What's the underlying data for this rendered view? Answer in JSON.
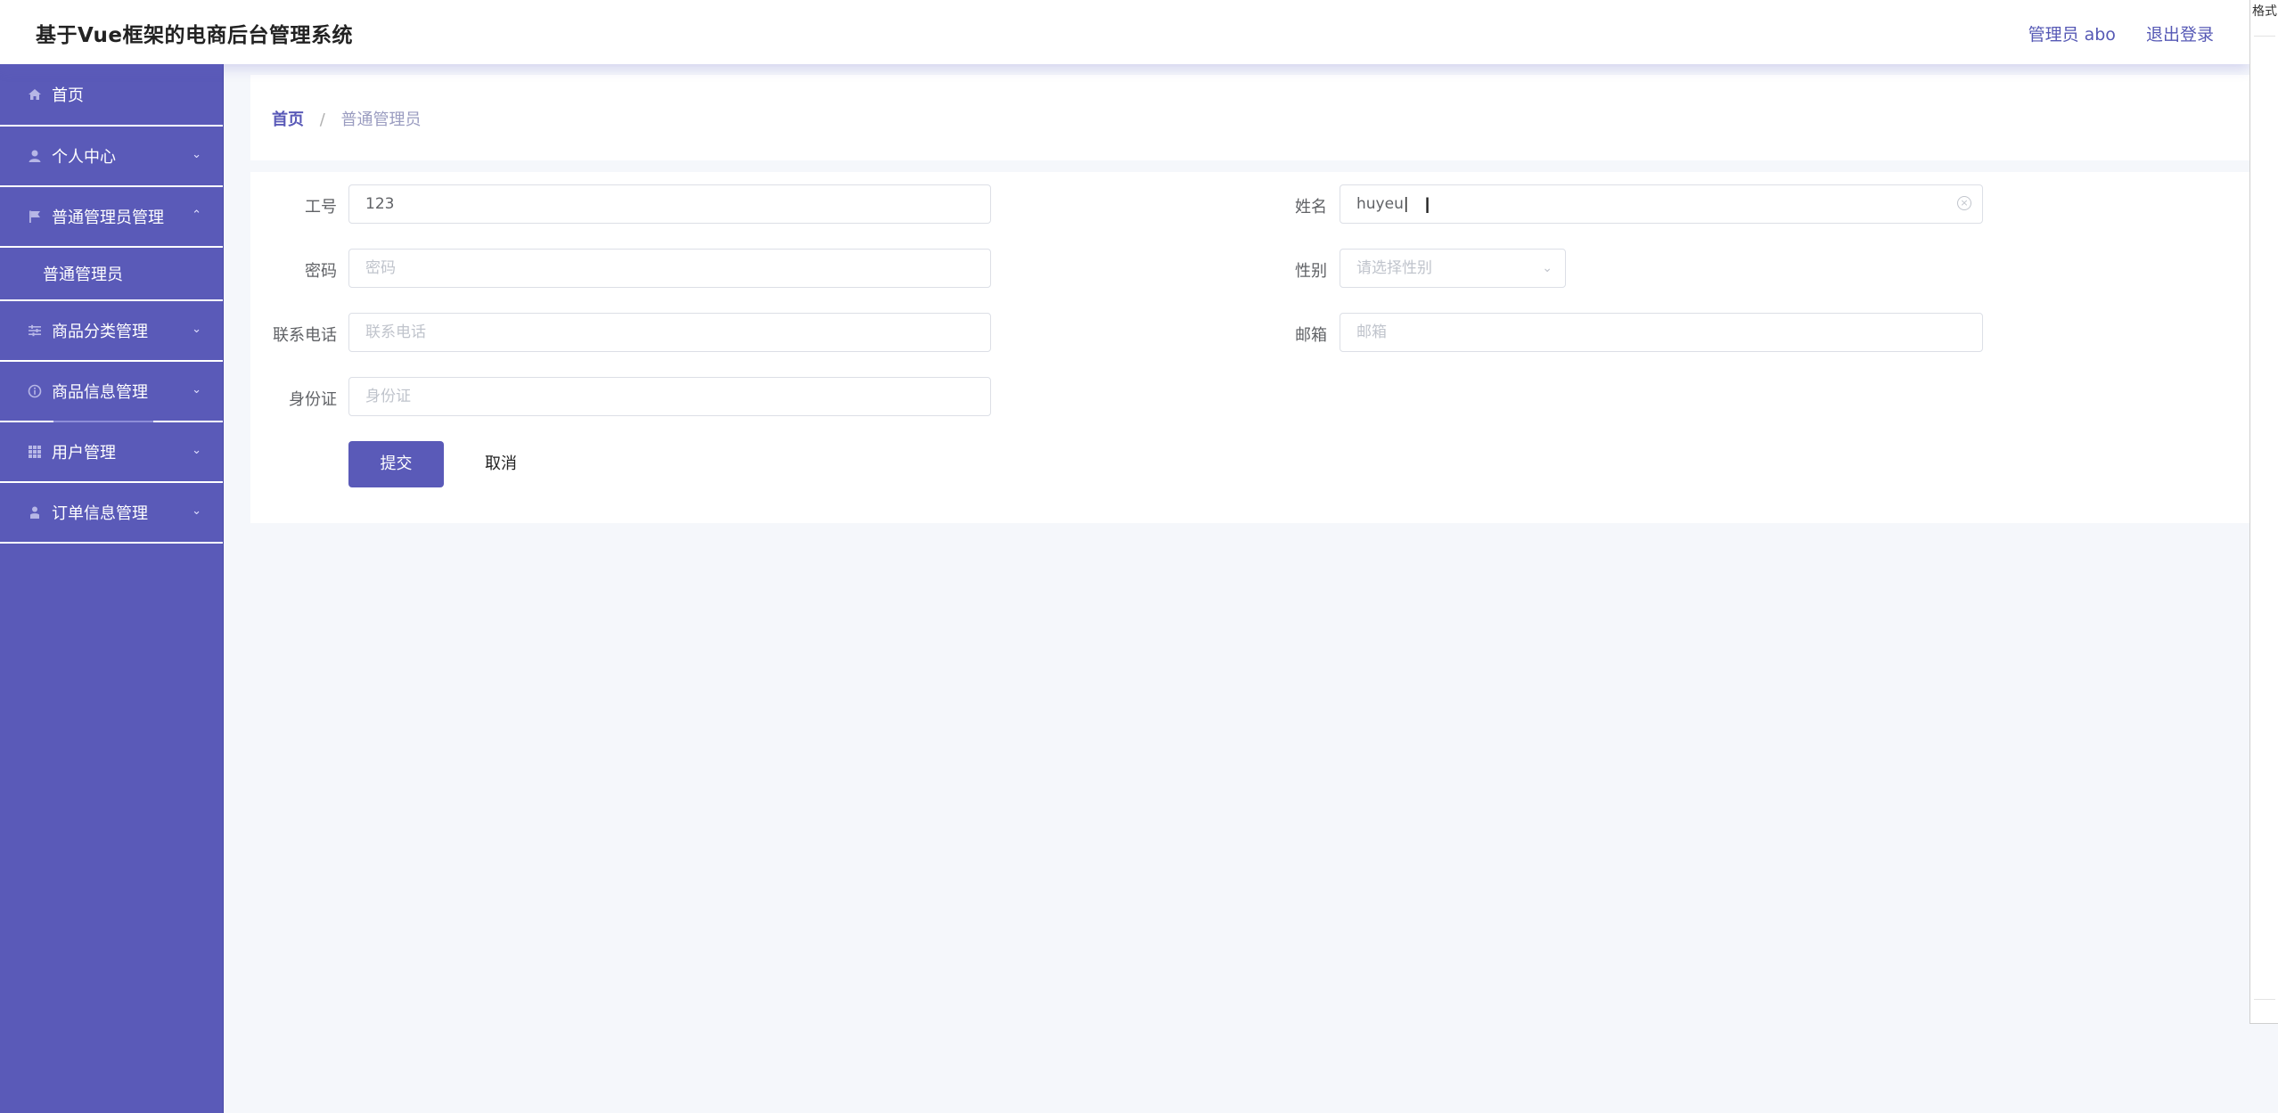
{
  "header": {
    "title": "基于Vue框架的电商后台管理系统",
    "user_label": "管理员 abo",
    "logout_label": "退出登录"
  },
  "side_window": {
    "fragment": "格式"
  },
  "sidebar": {
    "items": [
      {
        "label": "首页",
        "icon": "home-icon"
      },
      {
        "label": "个人中心",
        "icon": "user-icon"
      },
      {
        "label": "普通管理员管理",
        "icon": "flag-icon"
      },
      {
        "label": "普通管理员",
        "icon": ""
      },
      {
        "label": "商品分类管理",
        "icon": "sliders-icon"
      },
      {
        "label": "商品信息管理",
        "icon": "info-circle-icon"
      },
      {
        "label": "用户管理",
        "icon": "grid-icon"
      },
      {
        "label": "订单信息管理",
        "icon": "person-icon"
      }
    ]
  },
  "breadcrumb": {
    "home": "首页",
    "separator": "/",
    "current": "普通管理员"
  },
  "form": {
    "job_no": {
      "label": "工号",
      "value": "123"
    },
    "name": {
      "label": "姓名",
      "value": "huyeu"
    },
    "password": {
      "label": "密码",
      "placeholder": "密码"
    },
    "gender": {
      "label": "性别",
      "placeholder": "请选择性别"
    },
    "phone": {
      "label": "联系电话",
      "placeholder": "联系电话"
    },
    "email": {
      "label": "邮箱",
      "placeholder": "邮箱"
    },
    "id_card": {
      "label": "身份证",
      "placeholder": "身份证"
    },
    "submit_label": "提交",
    "cancel_label": "取消"
  },
  "colors": {
    "accent": "#5a5ab8",
    "background": "#f5f7fb"
  }
}
